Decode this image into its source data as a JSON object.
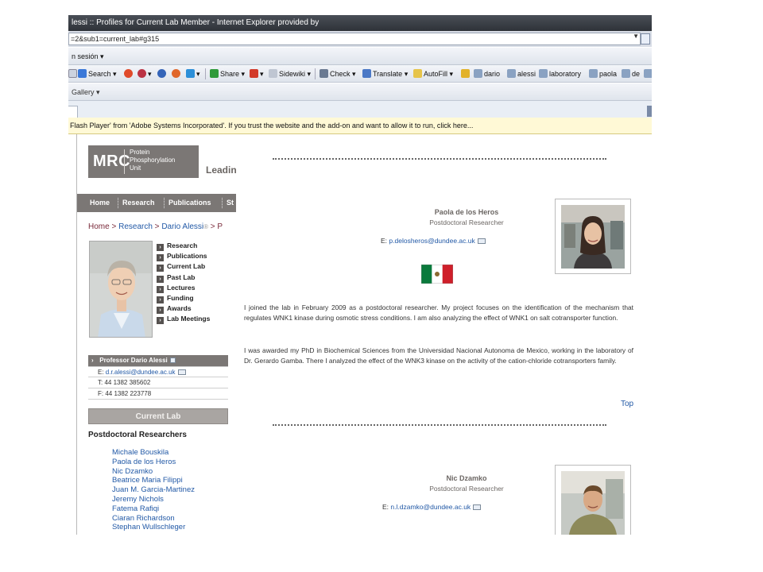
{
  "browser": {
    "title": "lessi :: Profiles for Current Lab Member - Internet Explorer provided by",
    "address": "=2&sub1=current_lab#g315",
    "menu_label": "n sesión ▾",
    "favorites_label": "Gallery ▾",
    "toolbar": {
      "search": "Search",
      "share": "Share",
      "sidewiki": "Sidewiki",
      "check": "Check",
      "translate": "Translate",
      "autofill": "AutoFill",
      "chips": [
        "dario",
        "alessi",
        "laboratory",
        "paola",
        "de"
      ]
    },
    "infobar": "Flash Player' from 'Adobe Systems Incorporated'. If you trust the website and the add-on and want to allow it to run, click here..."
  },
  "logo": {
    "mrc": "MRC",
    "unit_line1": "Protein",
    "unit_line2": "Phosphorylation",
    "unit_line3": "Unit",
    "tagline": "Leadin"
  },
  "nav": {
    "home": "Home",
    "research": "Research",
    "publications": "Publications",
    "cut": "St"
  },
  "breadcrumb": {
    "home": "Home",
    "sep1": " > ",
    "research": "Research",
    "sep2": " > ",
    "dario": "Dario Alessi",
    "tail": " > P"
  },
  "submenu": [
    "Research",
    "Publications",
    "Current Lab",
    "Past Lab",
    "Lectures",
    "Funding",
    "Awards",
    "Lab Meetings"
  ],
  "contact": {
    "head": "Professor Dario Alessi",
    "email_prefix": "E: ",
    "email": "d.r.alessi@dundee.ac.uk",
    "tel": "T: 44 1382 385602",
    "fax": "F: 44 1382 223778"
  },
  "current_lab_button": "Current Lab",
  "postdoc_heading": "Postdoctoral Researchers",
  "postdocs": [
    "Michale Bouskila",
    "Paola de los Heros",
    "Nic Dzamko",
    "Beatrice Maria Filippi",
    "Juan M. Garcia-Martinez",
    "Jeremy Nichols",
    "Fatema Rafiqi",
    "Ciaran Richardson",
    "Stephan Wullschleger"
  ],
  "profile1": {
    "name": "Paola de los Heros",
    "role": "Postdoctoral Researcher",
    "email_prefix": "E: ",
    "email": "p.delosheros@dundee.ac.uk",
    "para1": "I joined the lab in February 2009 as a postdoctoral researcher. My project focuses on the identification of the mechanism that regulates WNK1 kinase during osmotic stress conditions. I am also analyzing the effect of WNK1 on salt cotransporter function.",
    "para2": "I was awarded my PhD in Biochemical Sciences from the Universidad Nacional Autonoma de Mexico, working in the laboratory of Dr. Gerardo Gamba. There I analyzed the effect of the WNK3 kinase on the activity of the cation-chloride cotransporters family.",
    "top": "Top"
  },
  "profile2": {
    "name": "Nic Dzamko",
    "role": "Postdoctoral Researcher",
    "email_prefix": "E: ",
    "email": "n.l.dzamko@dundee.ac.uk"
  }
}
